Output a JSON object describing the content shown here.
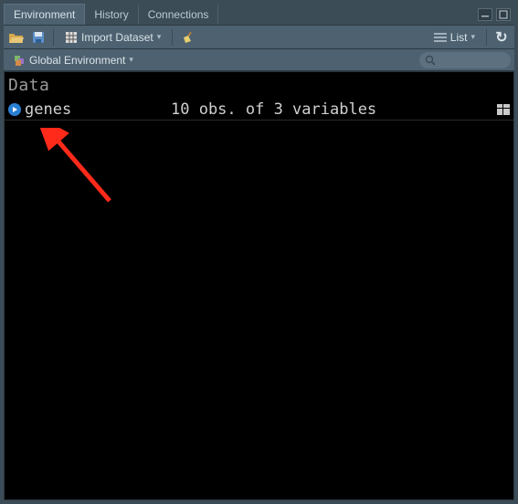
{
  "tabs": {
    "environment": "Environment",
    "history": "History",
    "connections": "Connections"
  },
  "toolbar": {
    "import_label": "Import Dataset",
    "view_label": "List"
  },
  "scope": {
    "label": "Global Environment"
  },
  "section": {
    "data_header": "Data"
  },
  "objects": [
    {
      "name": "genes",
      "desc": "10 obs. of 3 variables"
    }
  ]
}
